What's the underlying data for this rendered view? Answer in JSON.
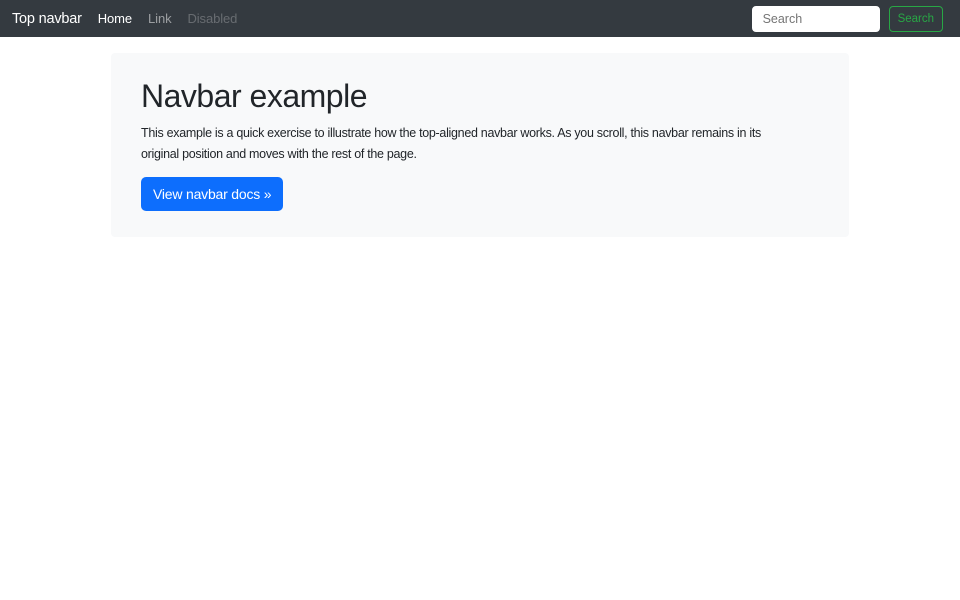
{
  "navbar": {
    "brand": "Top navbar",
    "links": [
      {
        "label": "Home",
        "state": "active"
      },
      {
        "label": "Link",
        "state": "normal"
      },
      {
        "label": "Disabled",
        "state": "disabled"
      }
    ],
    "search": {
      "placeholder": "Search",
      "button_label": "Search"
    }
  },
  "main": {
    "heading": "Navbar example",
    "description_lines": [
      "This example is a quick exercise to illustrate how the top-aligned navbar works. As you scroll, this navbar remains in its",
      "original position and moves with the rest of the page."
    ],
    "cta_label": "View navbar docs »"
  },
  "colors": {
    "navbar_bg": "#343a40",
    "primary": "#0d6efd",
    "success": "#28a745",
    "surface": "#f8f9fa",
    "text": "#212529"
  }
}
